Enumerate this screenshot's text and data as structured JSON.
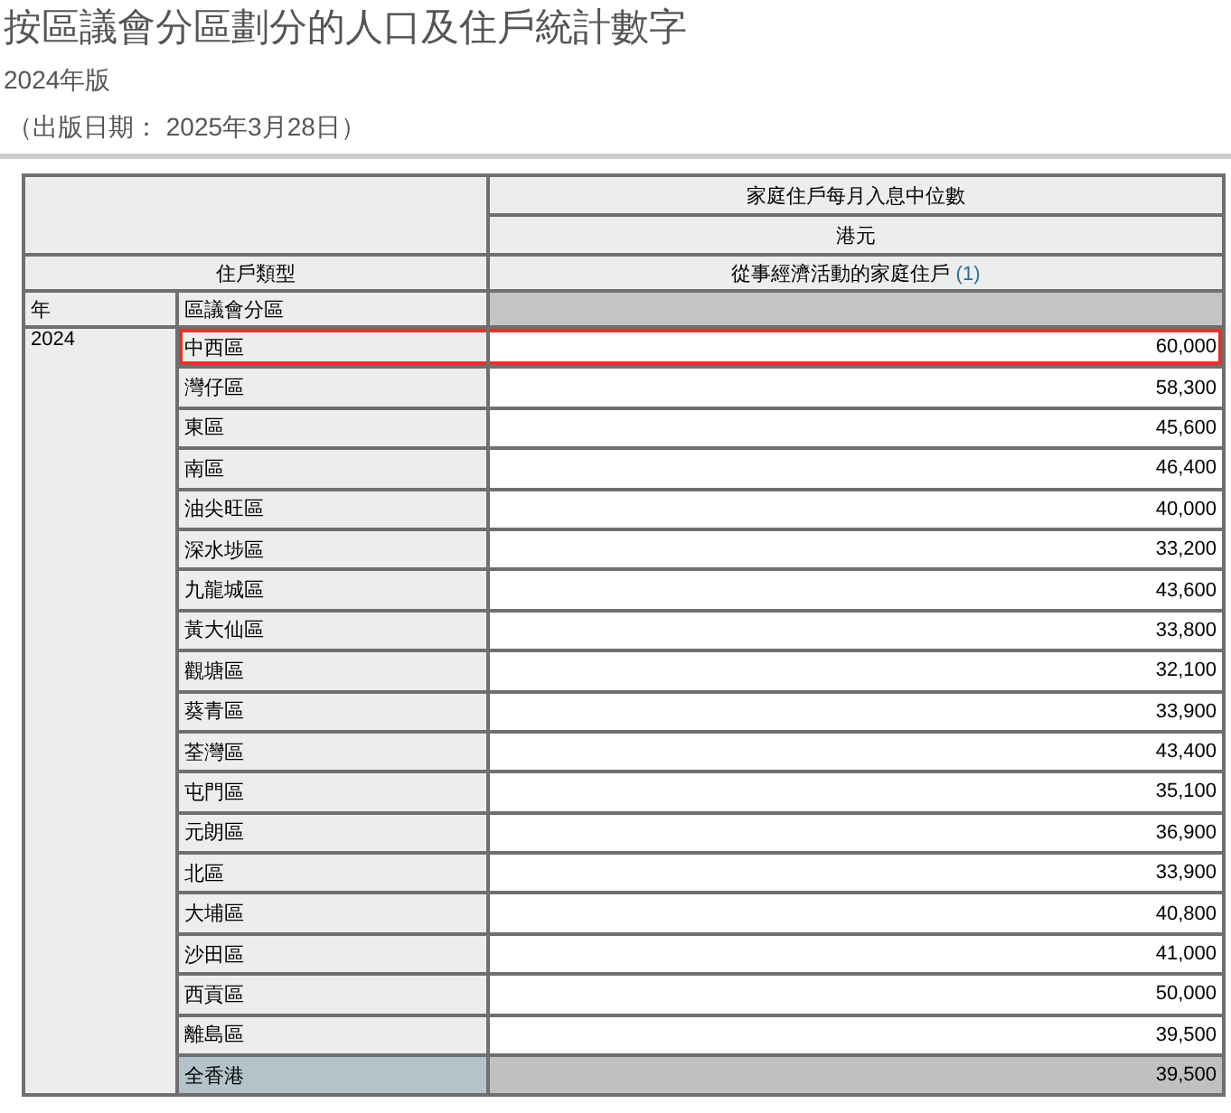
{
  "title": "按區議會分區劃分的人口及住戶統計數字",
  "edition": "2024年版",
  "publish_date": "（出版日期： 2025年3月28日）",
  "table": {
    "measure": "家庭住戶每月入息中位數",
    "unit": "港元",
    "type_label": "住戶類型",
    "household_type": {
      "label": "從事經濟活動的家庭住戶",
      "note": "(1)"
    },
    "year_header": "年",
    "district_header": "區議會分區",
    "year": "2024",
    "rows": [
      {
        "district": "中西區",
        "value": "60,000",
        "kind": "district",
        "highlighted": true
      },
      {
        "district": "灣仔區",
        "value": "58,300",
        "kind": "district",
        "highlighted": false
      },
      {
        "district": "東區",
        "value": "45,600",
        "kind": "district",
        "highlighted": false
      },
      {
        "district": "南區",
        "value": "46,400",
        "kind": "district",
        "highlighted": false
      },
      {
        "district": "油尖旺區",
        "value": "40,000",
        "kind": "district",
        "highlighted": false
      },
      {
        "district": "深水埗區",
        "value": "33,200",
        "kind": "district",
        "highlighted": false
      },
      {
        "district": "九龍城區",
        "value": "43,600",
        "kind": "district",
        "highlighted": false
      },
      {
        "district": "黃大仙區",
        "value": "33,800",
        "kind": "district",
        "highlighted": false
      },
      {
        "district": "觀塘區",
        "value": "32,100",
        "kind": "district",
        "highlighted": false
      },
      {
        "district": "葵青區",
        "value": "33,900",
        "kind": "district",
        "highlighted": false
      },
      {
        "district": "荃灣區",
        "value": "43,400",
        "kind": "district",
        "highlighted": false
      },
      {
        "district": "屯門區",
        "value": "35,100",
        "kind": "district",
        "highlighted": false
      },
      {
        "district": "元朗區",
        "value": "36,900",
        "kind": "district",
        "highlighted": false
      },
      {
        "district": "北區",
        "value": "33,900",
        "kind": "district",
        "highlighted": false
      },
      {
        "district": "大埔區",
        "value": "40,800",
        "kind": "district",
        "highlighted": false
      },
      {
        "district": "沙田區",
        "value": "41,000",
        "kind": "district",
        "highlighted": false
      },
      {
        "district": "西貢區",
        "value": "50,000",
        "kind": "district",
        "highlighted": false
      },
      {
        "district": "離島區",
        "value": "39,500",
        "kind": "district",
        "highlighted": false
      },
      {
        "district": "全香港",
        "value": "39,500",
        "kind": "total",
        "highlighted": false
      }
    ]
  }
}
